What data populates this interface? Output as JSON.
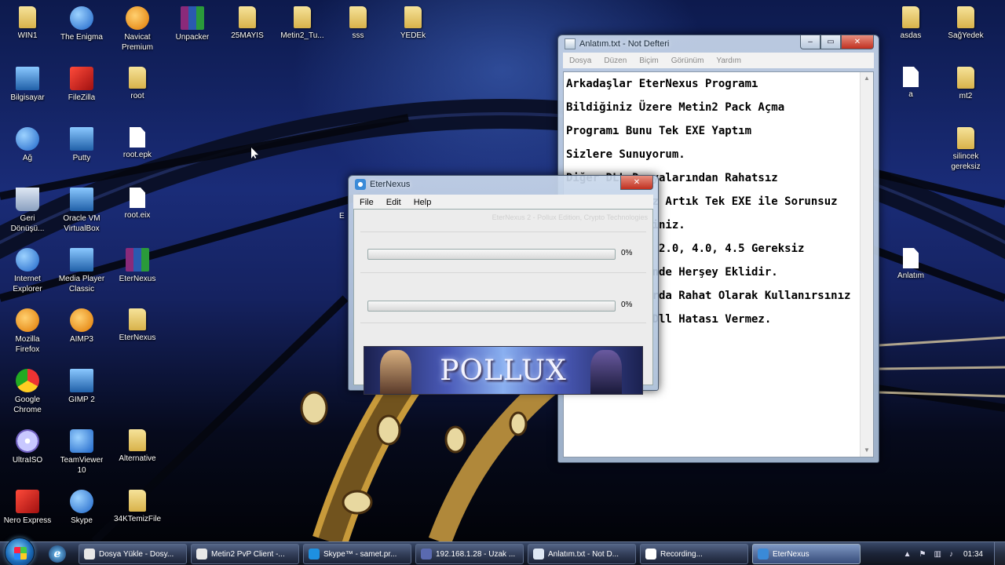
{
  "desktop_icons": {
    "win1": "WIN1",
    "enigma": "The Enigma",
    "navicat": "Navicat\nPremium",
    "unpacker": "Unpacker",
    "mayis": "25MAYIS",
    "metin2tu": "Metin2_Tu...",
    "sss": "sss",
    "yedek": "YEDEk",
    "bilgisayar": "Bilgisayar",
    "filezilla": "FileZilla",
    "root": "root",
    "ag": "Ağ",
    "putty": "Putty",
    "rootepk": "root.epk",
    "geri": "Geri\nDönüşü...",
    "virtualbox": "Oracle VM\nVirtualBox",
    "rooteix": "root.eix",
    "ie": "Internet\nExplorer",
    "mpc": "Media Player\nClassic",
    "eternexus1": "EterNexus",
    "firefox": "Mozilla\nFirefox",
    "aimp": "AIMP3",
    "eternexus2": "EterNexus",
    "chrome": "Google\nChrome",
    "gimp": "GIMP 2",
    "ultraiso": "UltraISO",
    "teamviewer": "TeamViewer\n10",
    "alternative": "Alternative",
    "nero": "Nero Express",
    "skype": "Skype",
    "temizfile": "34KTemizFile",
    "asdas": "asdas",
    "sagyedek": "SağYedek",
    "a": "a",
    "mt2": "mt2",
    "silincek": "silincek\ngereksiz",
    "anlatim": "Anlatım",
    "partial_e": "E"
  },
  "notepad": {
    "title": "Anlatım.txt - Not Defteri",
    "menu": [
      "Dosya",
      "Düzen",
      "Biçim",
      "Görünüm",
      "Yardım"
    ],
    "lines": [
      "Arkadaşlar EterNexus Programı",
      "Bildiğiniz Üzere Metin2 Pack Açma",
      "Programı Bunu Tek EXE Yaptım",
      "Sizlere Sunuyorum.",
      "Diğer DLL Dosyalarından Rahatsız",
      "Olmayacaksınız Artık Tek EXE ile Sorunsuz",
      "Kullanabilirsiniz.",
      "Net Framework 2.0, 4.0, 4.5 Gereksiz",
      "Çünkü İçerisinde Herşey Eklidir.",
      "Her Bilgisayarda Rahat Olarak Kullanırsınız",
      "Hiçbir Zaman Dll Hatası Vermez."
    ]
  },
  "eternexus": {
    "title": "EterNexus",
    "menu": [
      "File",
      "Edit",
      "Help"
    ],
    "credit": "EterNexus 2 - Pollux Edition, Crypto Technologies",
    "progress1": {
      "value": 0,
      "label": "0%"
    },
    "progress2": {
      "value": 0,
      "label": "0%"
    },
    "banner_text": "POLLUX"
  },
  "taskbar": {
    "tasks": [
      "Dosya Yükle - Dosy...",
      "Metin2 PvP Client -...",
      "Skype™ - samet.pr...",
      "192.168.1.28 - Uzak ...",
      "Anlatım.txt - Not D...",
      "Recording...",
      "EterNexus"
    ],
    "clock": "01:34"
  },
  "colors": {
    "progress_fill": "#3cb043",
    "taskbar": "#1c2438",
    "window_frame": "#c8d7eb"
  }
}
